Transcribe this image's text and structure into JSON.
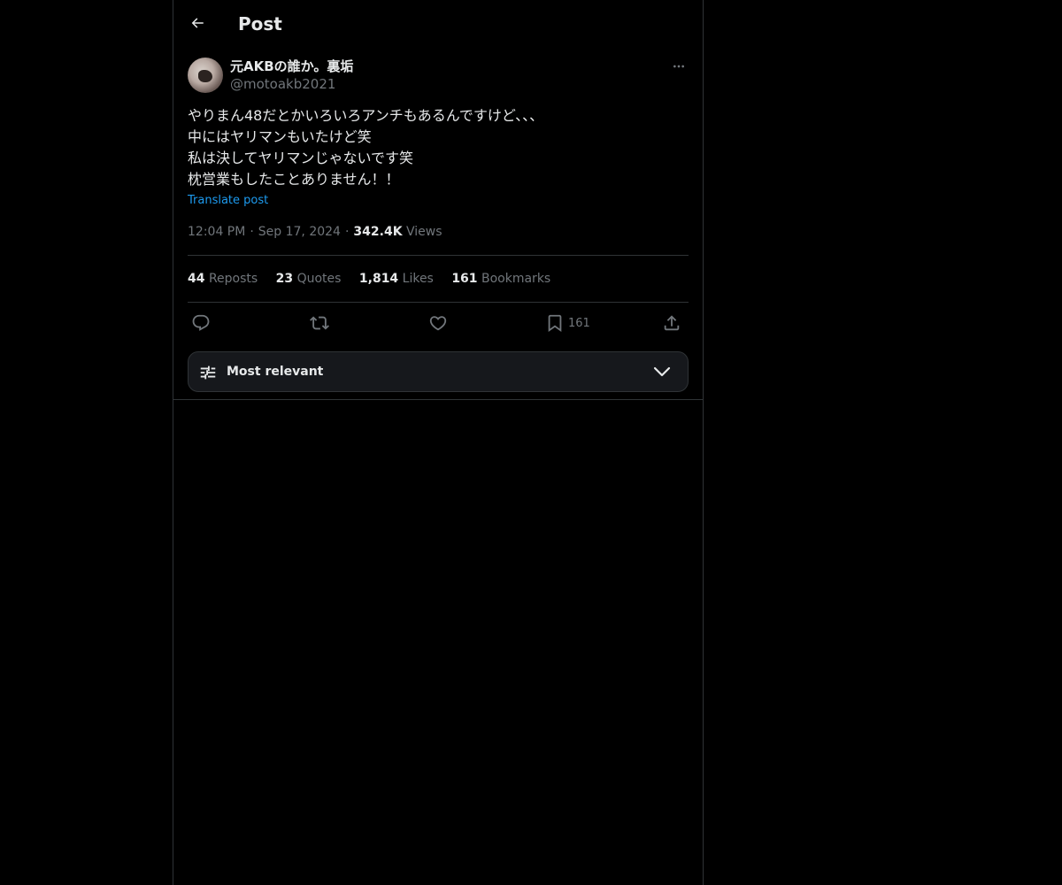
{
  "header": {
    "title": "Post",
    "back_icon": "arrow-left-icon"
  },
  "post": {
    "author": {
      "display_name": "元AKBの誰か。裏垢",
      "handle": "@motoakb2021"
    },
    "text_lines": [
      "やりまん48だとかいろいろアンチもあるんですけど、、、",
      "中にはヤリマンもいたけど笑",
      "私は決してヤリマンじゃないです笑",
      "枕営業もしたことありません！！"
    ],
    "translate_label": "Translate post",
    "time": "12:04 PM",
    "date": "Sep 17, 2024",
    "views_count": "342.4K",
    "views_label": "Views",
    "separator": "·"
  },
  "stats": {
    "reposts": {
      "count": "44",
      "label": "Reposts"
    },
    "quotes": {
      "count": "23",
      "label": "Quotes"
    },
    "likes": {
      "count": "1,814",
      "label": "Likes"
    },
    "bookmarks": {
      "count": "161",
      "label": "Bookmarks"
    }
  },
  "actions": {
    "reply_icon": "reply-icon",
    "repost_icon": "repost-icon",
    "like_icon": "heart-icon",
    "bookmark_icon": "bookmark-icon",
    "bookmark_count": "161",
    "share_icon": "share-icon"
  },
  "sort": {
    "label": "Most relevant",
    "icon": "tune-icon",
    "chevron": "chevron-down-icon"
  },
  "colors": {
    "background": "#000000",
    "text": "#e7e9ea",
    "muted": "#71767b",
    "link": "#1d9bf0",
    "border": "#2f3336"
  }
}
